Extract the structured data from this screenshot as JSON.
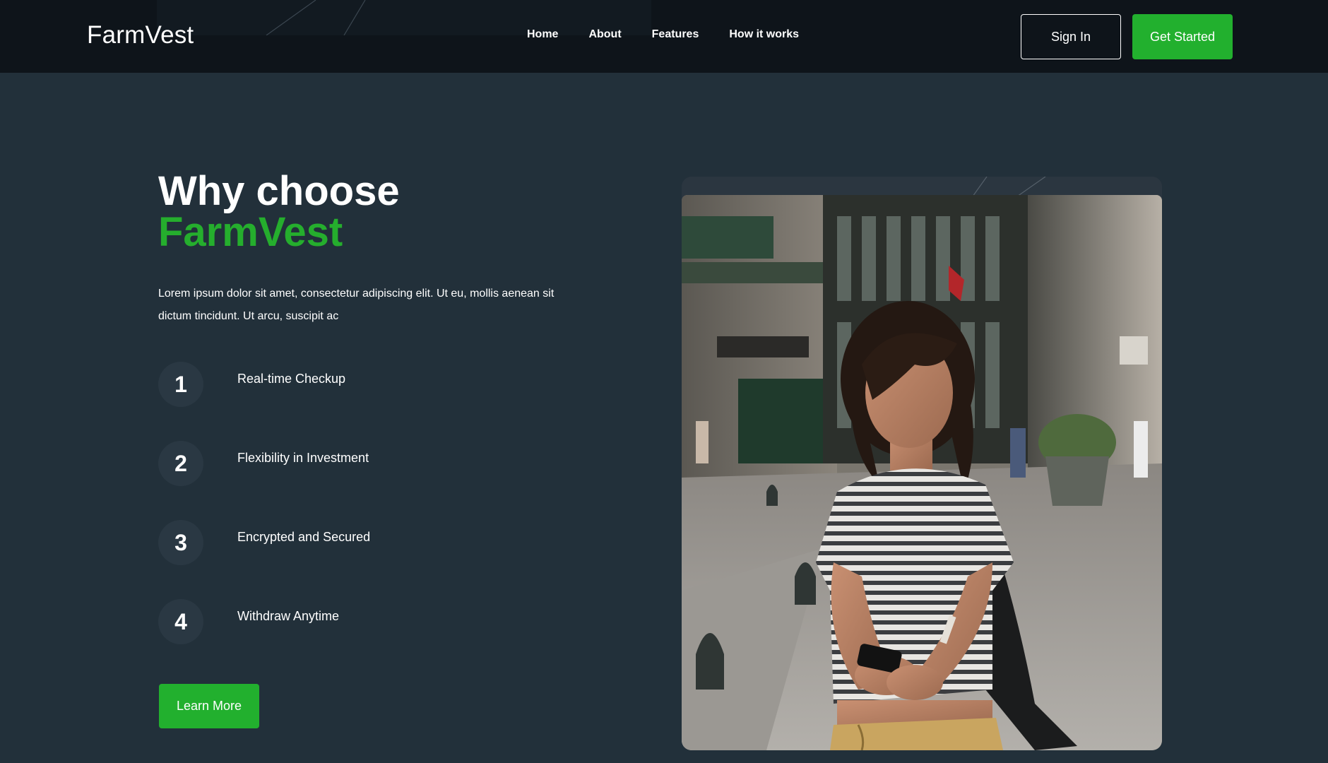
{
  "header": {
    "logo": "FarmVest",
    "nav": [
      "Home",
      "About",
      "Features",
      "How it works"
    ],
    "sign_in": "Sign In",
    "get_started": "Get Started"
  },
  "section": {
    "title_line1": "Why choose",
    "title_line2": "FarmVest",
    "intro": "Lorem ipsum dolor sit amet, consectetur adipiscing elit. Ut eu, mollis aenean sit dictum tincidunt. Ut arcu, suscipit ac",
    "features": [
      {
        "number": "1",
        "label": "Real-time Checkup"
      },
      {
        "number": "2",
        "label": "Flexibility in Investment"
      },
      {
        "number": "3",
        "label": "Encrypted and Secured"
      },
      {
        "number": "4",
        "label": "Withdraw Anytime"
      }
    ],
    "learn_more": "Learn More"
  },
  "colors": {
    "accent_green": "#22b02e",
    "background": "#22303a",
    "navbar": "#0e141a"
  },
  "photo": {
    "subject": "woman-using-phone-on-street-photo"
  }
}
